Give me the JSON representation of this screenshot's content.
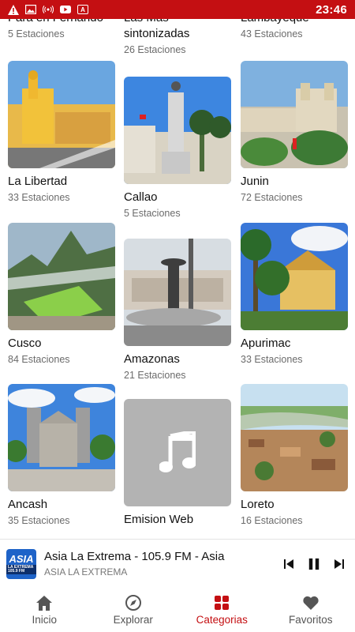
{
  "status_bar": {
    "time": "23:46",
    "icons": [
      "alert-icon",
      "image-icon",
      "broadcast-icon",
      "youtube-icon",
      "a-icon"
    ]
  },
  "colors": {
    "accent": "#c40f12",
    "muted": "#6b6b6b"
  },
  "grid": {
    "top_partial": [
      {
        "name": "",
        "count": "5 Estaciones"
      },
      {
        "name": "sintonizadas",
        "count": "26 Estaciones"
      },
      {
        "name": "",
        "count": "43 Estaciones"
      }
    ],
    "cards": [
      {
        "name": "La Libertad",
        "count": "33 Estaciones",
        "image": "plaza-cathedral-image"
      },
      {
        "name": "Callao",
        "count": "5 Estaciones",
        "image": "monument-image"
      },
      {
        "name": "Junin",
        "count": "72 Estaciones",
        "image": "plaza-town-image"
      },
      {
        "name": "Cusco",
        "count": "84 Estaciones",
        "image": "machu-picchu-image"
      },
      {
        "name": "Amazonas",
        "count": "21 Estaciones",
        "image": "fountain-image"
      },
      {
        "name": "Apurimac",
        "count": "33 Estaciones",
        "image": "palm-plaza-image"
      },
      {
        "name": "Ancash",
        "count": "35 Estaciones",
        "image": "church-image"
      },
      {
        "name": "Emision Web",
        "count": "",
        "image": "music-note-icon"
      },
      {
        "name": "Loreto",
        "count": "16 Estaciones",
        "image": "aerial-city-image"
      }
    ]
  },
  "player": {
    "logo_text": "ASIA",
    "logo_sub": "LA EXTREMA 105.9 FM",
    "title": "Asia La Extrema - 105.9 FM - Asia",
    "subtitle": "ASIA LA EXTREMA",
    "controls": [
      "skip-previous-icon",
      "pause-icon",
      "skip-next-icon"
    ]
  },
  "nav": {
    "items": [
      {
        "label": "Inicio",
        "icon": "home-icon",
        "active": false
      },
      {
        "label": "Explorar",
        "icon": "compass-icon",
        "active": false
      },
      {
        "label": "Categorias",
        "icon": "grid-icon",
        "active": true
      },
      {
        "label": "Favoritos",
        "icon": "heart-icon",
        "active": false
      }
    ]
  }
}
